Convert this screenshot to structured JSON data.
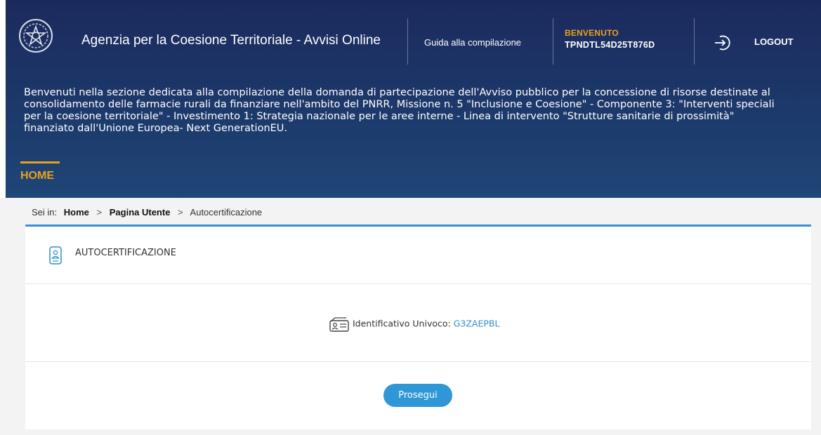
{
  "header": {
    "app_title": "Agenzia per la Coesione Territoriale - Avvisi Online",
    "guide_link": "Guida alla compilazione",
    "welcome_label": "BENVENUTO",
    "user_code": "TPNDTL54D25T876D",
    "logout_label": "LOGOUT",
    "intro_lines": [
      "Benvenuti nella sezione dedicata alla compilazione della domanda di partecipazione dell'Avviso pubblico per la concessione di risorse destinate al",
      "consolidamento delle farmacie rurali da finanziare nell'ambito del PNRR, Missione n. 5 \"Inclusione e Coesione\" - Componente 3: \"Interventi speciali",
      "per la coesione territoriale\" - Investimento 1: Strategia nazionale per le aree interne - Linea di intervento \"Strutture sanitarie di prossimità\"",
      "finanziato dall'Unione Europea- Next GenerationEU."
    ],
    "nav_home": "HOME"
  },
  "breadcrumb": {
    "prefix": "Sei in:",
    "items": [
      "Home",
      "Pagina Utente",
      "Autocertificazione"
    ],
    "separator": ">"
  },
  "card": {
    "title": "AUTOCERTIFICAZIONE",
    "id_label": "Identificativo Univoco:",
    "id_value": "G3ZAEPBL",
    "proceed_button": "Prosegui"
  },
  "colors": {
    "header_bg": "#1d3a6c",
    "accent_orange": "#e8a21a",
    "accent_blue": "#2f97d6",
    "card_border": "#3b8fd4"
  },
  "icons": {
    "emblem": "italian-republic-emblem",
    "logout": "logout-arrow-icon",
    "card": "user-badge-icon",
    "id": "id-card-icon"
  }
}
